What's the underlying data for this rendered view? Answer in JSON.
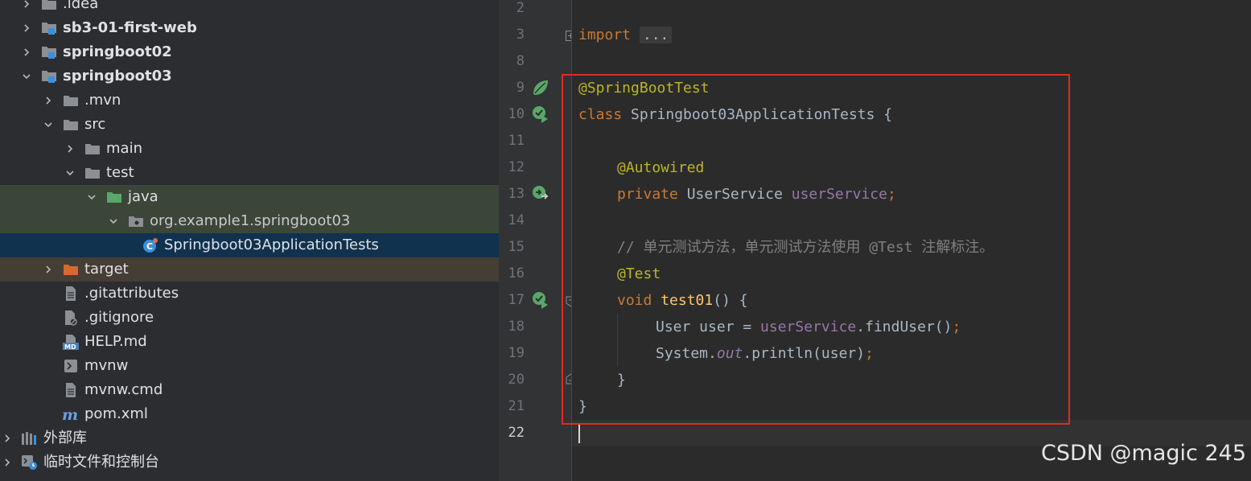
{
  "tree": {
    "items": [
      {
        "label": ".idea"
      },
      {
        "label": "sb3-01-first-web"
      },
      {
        "label": "springboot02"
      },
      {
        "label": "springboot03"
      },
      {
        "label": ".mvn"
      },
      {
        "label": "src"
      },
      {
        "label": "main"
      },
      {
        "label": "test"
      },
      {
        "label": "java"
      },
      {
        "label": "org.example1.springboot03"
      },
      {
        "label": "Springboot03ApplicationTests"
      },
      {
        "label": "target"
      },
      {
        "label": ".gitattributes"
      },
      {
        "label": ".gitignore"
      },
      {
        "label": "HELP.md"
      },
      {
        "label": "mvnw"
      },
      {
        "label": "mvnw.cmd"
      },
      {
        "label": "pom.xml"
      },
      {
        "label": "外部库"
      },
      {
        "label": "临时文件和控制台"
      }
    ]
  },
  "gutter": {
    "lines": [
      "2",
      "3",
      "8",
      "9",
      "10",
      "11",
      "12",
      "13",
      "14",
      "15",
      "16",
      "17",
      "18",
      "19",
      "20",
      "21",
      "22"
    ]
  },
  "code": {
    "l3_kw": "import",
    "l3_fold": "...",
    "l9_ann": "@SpringBootTest",
    "l10_kw": "class",
    "l10_rest": " Springboot03ApplicationTests {",
    "l12_ann": "@Autowired",
    "l13_kw": "private",
    "l13_type": " UserService ",
    "l13_field": "userService",
    "l13_semi": ";",
    "l15_cmt": "// 单元测试方法，单元测试方法使用 @Test 注解标注。",
    "l16_ann": "@Test",
    "l17_kw": "void",
    "l17_sp": " ",
    "l17_mth": "test01",
    "l17_rest": "() {",
    "l18_a": "User user = ",
    "l18_field": "userService",
    "l18_b": ".findUser()",
    "l18_semi": ";",
    "l19_a": "System.",
    "l19_out": "out",
    "l19_b": ".println(user)",
    "l19_semi": ";",
    "l20": "}",
    "l21": "}"
  },
  "watermark": "CSDN @magic 245",
  "colors": {
    "keyword": "#cc7832",
    "annotation": "#bbb529",
    "field": "#9876aa",
    "method": "#ffc66d",
    "highlight_box": "#e02b20"
  }
}
